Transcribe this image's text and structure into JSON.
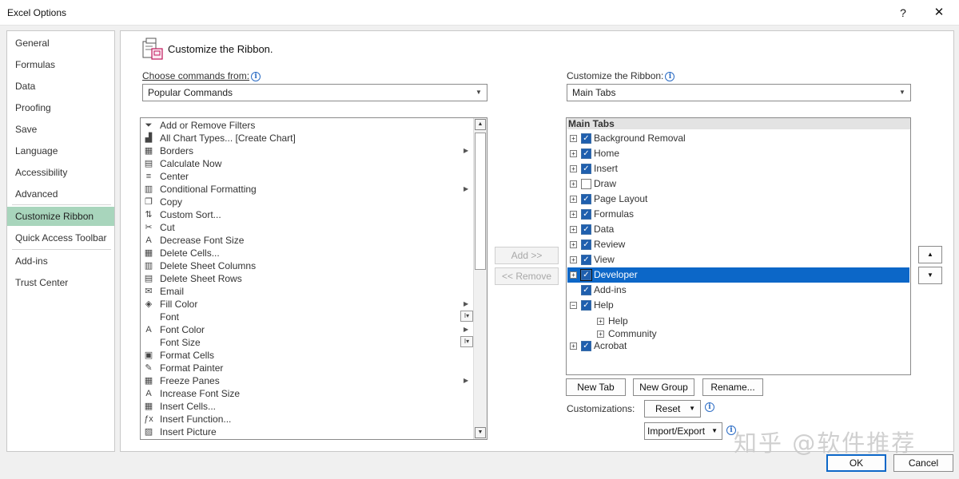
{
  "window": {
    "title": "Excel Options",
    "help": "?",
    "close": "✕"
  },
  "nav": {
    "items": [
      {
        "label": "General"
      },
      {
        "label": "Formulas"
      },
      {
        "label": "Data"
      },
      {
        "label": "Proofing"
      },
      {
        "label": "Save"
      },
      {
        "label": "Language"
      },
      {
        "label": "Accessibility"
      },
      {
        "label": "Advanced"
      },
      {
        "label": "Customize Ribbon"
      },
      {
        "label": "Quick Access Toolbar"
      },
      {
        "label": "Add-ins"
      },
      {
        "label": "Trust Center"
      }
    ],
    "selected": "Customize Ribbon"
  },
  "heading": "Customize the Ribbon.",
  "commands": {
    "label": "Choose commands from:",
    "info": "i",
    "dropdown_value": "Popular Commands",
    "items": [
      {
        "label": "Add or Remove Filters",
        "icon": "filter-icon",
        "glyph": "⏷"
      },
      {
        "label": "All Chart Types... [Create Chart]",
        "icon": "chart-icon",
        "glyph": "▟"
      },
      {
        "label": "Borders",
        "icon": "borders-icon",
        "glyph": "▦",
        "sub": "▶"
      },
      {
        "label": "Calculate Now",
        "icon": "calculator-icon",
        "glyph": "▤"
      },
      {
        "label": "Center",
        "icon": "align-center-icon",
        "glyph": "≡"
      },
      {
        "label": "Conditional Formatting",
        "icon": "conditional-formatting-icon",
        "glyph": "▥",
        "sub": "▶"
      },
      {
        "label": "Copy",
        "icon": "copy-icon",
        "glyph": "❐"
      },
      {
        "label": "Custom Sort...",
        "icon": "sort-icon",
        "glyph": "⇅"
      },
      {
        "label": "Cut",
        "icon": "scissors-icon",
        "glyph": "✂"
      },
      {
        "label": "Decrease Font Size",
        "icon": "decrease-font-icon",
        "glyph": "A"
      },
      {
        "label": "Delete Cells...",
        "icon": "delete-cells-icon",
        "glyph": "▦"
      },
      {
        "label": "Delete Sheet Columns",
        "icon": "delete-columns-icon",
        "glyph": "▥"
      },
      {
        "label": "Delete Sheet Rows",
        "icon": "delete-rows-icon",
        "glyph": "▤"
      },
      {
        "label": "Email",
        "icon": "email-icon",
        "glyph": "✉"
      },
      {
        "label": "Fill Color",
        "icon": "fill-color-icon",
        "glyph": "◈",
        "sub": "▶"
      },
      {
        "label": "Font",
        "icon": "font-icon",
        "glyph": "",
        "box": "I▾"
      },
      {
        "label": "Font Color",
        "icon": "font-color-icon",
        "glyph": "A",
        "sub": "▶"
      },
      {
        "label": "Font Size",
        "icon": "font-size-icon",
        "glyph": "",
        "box": "I▾"
      },
      {
        "label": "Format Cells",
        "icon": "format-cells-icon",
        "glyph": "▣"
      },
      {
        "label": "Format Painter",
        "icon": "format-painter-icon",
        "glyph": "✎"
      },
      {
        "label": "Freeze Panes",
        "icon": "freeze-panes-icon",
        "glyph": "▦",
        "sub": "▶"
      },
      {
        "label": "Increase Font Size",
        "icon": "increase-font-icon",
        "glyph": "A"
      },
      {
        "label": "Insert Cells...",
        "icon": "insert-cells-icon",
        "glyph": "▦"
      },
      {
        "label": "Insert Function...",
        "icon": "function-icon",
        "glyph": "ƒx"
      },
      {
        "label": "Insert Picture",
        "icon": "picture-icon",
        "glyph": "▨"
      }
    ]
  },
  "buttons": {
    "add": "Add >>",
    "remove": "<< Remove"
  },
  "ribbon": {
    "label": "Customize the Ribbon:",
    "info": "i",
    "dropdown_value": "Main Tabs",
    "tree_header": "Main Tabs",
    "tabs": [
      {
        "label": "Background Removal",
        "checked": true,
        "level": 0,
        "expander": "+"
      },
      {
        "label": "Home",
        "checked": true,
        "level": 0,
        "expander": "+"
      },
      {
        "label": "Insert",
        "checked": true,
        "level": 0,
        "expander": "+"
      },
      {
        "label": "Draw",
        "checked": false,
        "level": 0,
        "expander": "+"
      },
      {
        "label": "Page Layout",
        "checked": true,
        "level": 0,
        "expander": "+"
      },
      {
        "label": "Formulas",
        "checked": true,
        "level": 0,
        "expander": "+"
      },
      {
        "label": "Data",
        "checked": true,
        "level": 0,
        "expander": "+"
      },
      {
        "label": "Review",
        "checked": true,
        "level": 0,
        "expander": "+"
      },
      {
        "label": "View",
        "checked": true,
        "level": 0,
        "expander": "+"
      },
      {
        "label": "Developer",
        "checked": true,
        "level": 0,
        "expander": "+",
        "selected": true
      },
      {
        "label": "Add-ins",
        "checked": true,
        "level": 0,
        "expander": ""
      },
      {
        "label": "Help",
        "checked": true,
        "level": 0,
        "expander": "−"
      },
      {
        "label": "Help",
        "checked": null,
        "level": 1,
        "expander": "+"
      },
      {
        "label": "Community",
        "checked": null,
        "level": 1,
        "expander": "+"
      },
      {
        "label": "Acrobat",
        "checked": true,
        "level": 0,
        "expander": "+"
      }
    ],
    "new_tab": "New Tab",
    "new_group": "New Group",
    "rename": "Rename...",
    "customizations_label": "Customizations:",
    "reset": "Reset",
    "import_export": "Import/Export",
    "move_up": "▲",
    "move_down": "▼"
  },
  "footer": {
    "ok": "OK",
    "cancel": "Cancel"
  },
  "watermark": "知乎 @软件推荐"
}
